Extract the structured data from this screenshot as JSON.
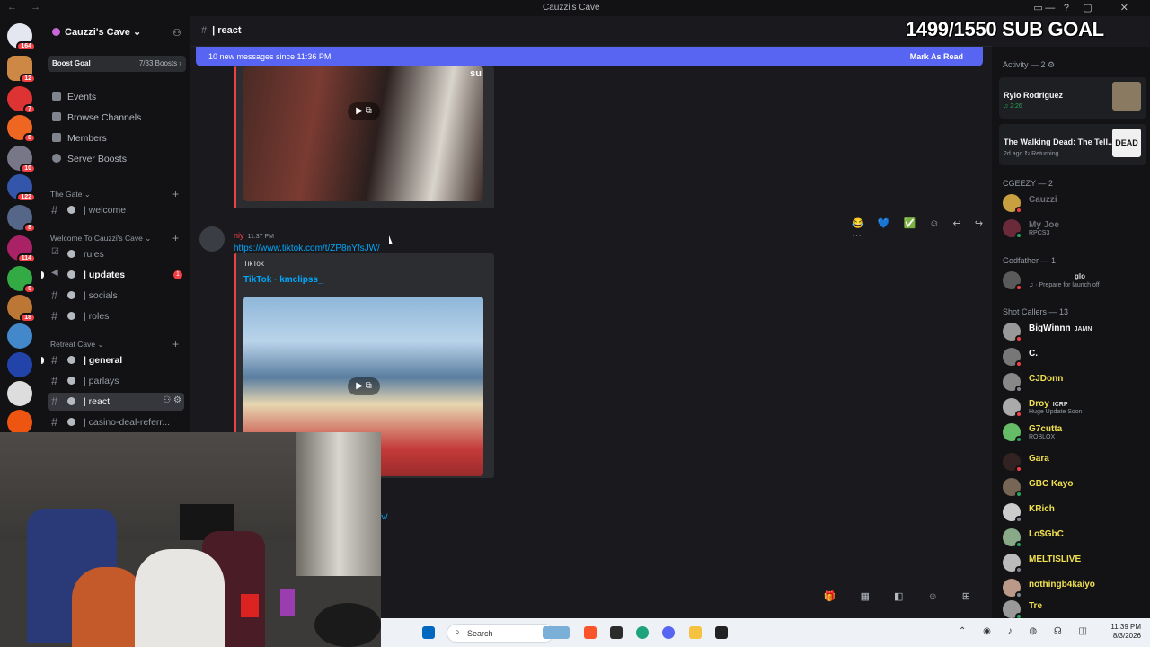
{
  "window": {
    "title": "Cauzzi's Cave",
    "nav": "← →"
  },
  "guild": {
    "name": "Cauzzi's Cave ⌄",
    "boost_label": "Boost Goal",
    "boost_count": "7/33 Boosts ›",
    "menu": [
      "Events",
      "Browse Channels",
      "Members",
      "Server Boosts"
    ],
    "categories": [
      "The Gate ⌄",
      "Welcome To Cauzzi's Cave ⌄",
      "Retreat Cave ⌄"
    ],
    "channels": [
      {
        "name": "| welcome"
      },
      {
        "name": "rules"
      },
      {
        "name": "| updates",
        "mentions": "1"
      },
      {
        "name": "| socials"
      },
      {
        "name": "| roles"
      },
      {
        "name": "| general"
      },
      {
        "name": "| parlays"
      },
      {
        "name": "| react"
      },
      {
        "name": "| casino-deal-referr..."
      }
    ]
  },
  "server_badges": [
    "164",
    "12",
    "7",
    "8",
    "10",
    "122",
    "8",
    "114",
    "6",
    "18"
  ],
  "header": {
    "channel": "| react"
  },
  "overlay": {
    "sub_goal": "1499/1550 SUB GOAL"
  },
  "new_messages": {
    "text": "10 new messages since 11:36 PM",
    "action": "Mark As Read"
  },
  "messages": [
    {
      "author": "niy",
      "time": "11:37 PM",
      "link": "https://www.tiktok.com/t/ZP8nYfsJW/",
      "embed_provider": "TikTok",
      "embed_title": "TikTok · kmclipss_"
    }
  ],
  "partial_link": "fv/",
  "top_embed_caption": "su",
  "members": {
    "activity_header": "Activity — 2",
    "activity": [
      {
        "title": "Rylo Rodriguez",
        "sub": "♫ 2:26"
      },
      {
        "title": "The Walking Dead: The Tell...",
        "sub": "2d ago  ↻ Returning",
        "thumb_text": "DEAD"
      }
    ],
    "groups": [
      {
        "name": "CGEEZY — 2",
        "members": [
          {
            "name": "Cauzzi",
            "color": "#dbdee1",
            "sub": ""
          },
          {
            "name": "My Joe",
            "color": "#dbdee1",
            "sub": "RPCS3"
          }
        ]
      },
      {
        "name": "Godfather — 1",
        "members": [
          {
            "name": "glo",
            "color": "#dbdee1",
            "sub": "♫ · Prepare for launch off"
          }
        ]
      },
      {
        "name": "Shot Callers — 13",
        "members": [
          {
            "name": "BigWinnn",
            "color": "#ffffff",
            "tag": "JAMN",
            "sub": ""
          },
          {
            "name": "C.",
            "color": "#ffffff",
            "sub": ""
          },
          {
            "name": "CJDonn",
            "color": "#f0e050",
            "sub": ""
          },
          {
            "name": "Droy",
            "color": "#f0e050",
            "tag": "ICRP",
            "sub": "Huge Update Soon"
          },
          {
            "name": "G7cutta",
            "color": "#f0e050",
            "sub": "ROBLOX"
          },
          {
            "name": "Gara",
            "color": "#f0e050",
            "sub": ""
          },
          {
            "name": "GBC Kayo",
            "color": "#f0e050",
            "sub": ""
          },
          {
            "name": "KRich",
            "color": "#f0e050",
            "sub": ""
          },
          {
            "name": "Lo$GbC",
            "color": "#f0e050",
            "sub": ""
          },
          {
            "name": "MELTISLIVE",
            "color": "#f0e050",
            "sub": ""
          },
          {
            "name": "nothingb4kaiyo",
            "color": "#f0e050",
            "sub": ""
          },
          {
            "name": "Tre",
            "color": "#f0e050",
            "sub": ""
          }
        ]
      }
    ]
  },
  "taskbar": {
    "search_placeholder": "Search",
    "time": "11:39 PM",
    "date": "8/3/2026"
  },
  "colors": {
    "accent": "#5865f2",
    "mention": "#f23f43",
    "link": "#00a8fc",
    "author": "#ed4245"
  }
}
